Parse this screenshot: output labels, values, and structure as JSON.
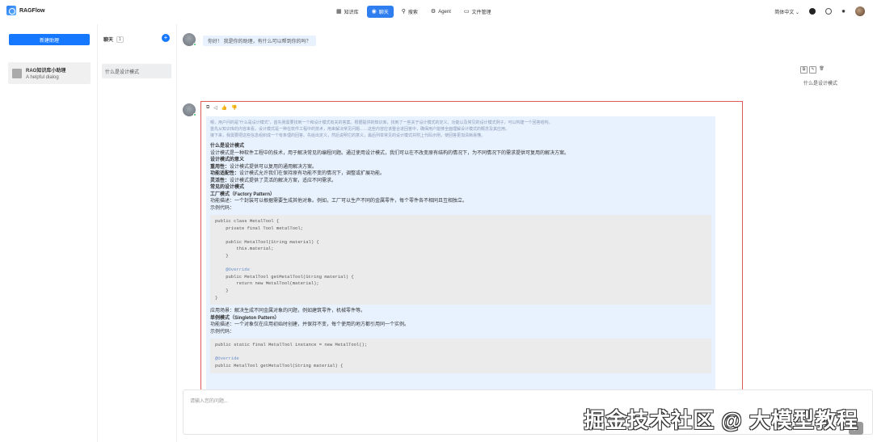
{
  "app": {
    "title": "RAGFlow"
  },
  "nav": {
    "items": [
      {
        "icon": "knowledge-base-icon",
        "label": "知识库",
        "active": false
      },
      {
        "icon": "chat-icon",
        "label": "聊天",
        "active": true
      },
      {
        "icon": "search-icon",
        "label": "搜索",
        "active": false
      },
      {
        "icon": "agent-icon",
        "label": "Agent",
        "active": false
      },
      {
        "icon": "folder-icon",
        "label": "文件管理",
        "active": false
      }
    ]
  },
  "topright": {
    "language": "简体中文"
  },
  "sidebar": {
    "new_chat_label": "新建助理",
    "assistant": {
      "name": "RAG知识库小助理",
      "description": "A helpful dialog"
    }
  },
  "conversations": {
    "title": "聊天",
    "count": "1",
    "items": [
      {
        "label": "什么是设计模式"
      }
    ]
  },
  "chat": {
    "greeting": "你好！ 我是你的助理，有什么可以帮到你的吗？",
    "user_message": "什么是设计模式",
    "thinking": [
      "嗯，用户问的是\"什么是设计模式\"，首先我需要找到一个和设计模式有关的答案。根据提供的知识库，找到了一些关于设计模式的定义、功能以及常见的设计模式例子，可以构建一个回答结构。",
      "首先从知识库的内容来看，设计模式是一种在软件工程中的技术，用来解决常见问题……这些内容应该整合进回答中，确保用户能够全面理解设计模式的概念及其应用。",
      "接下来，我需要把这些信息组织成一个有条理的回答。先给出定义，然后说明它的意义，最后列举常见的设计模式并附上代码示例，使回答更加清晰易懂。"
    ],
    "answer": {
      "h_what": "什么是设计模式",
      "p_what": "设计模式是一种软件工程中的技术，用于解决常见的编程问题。通过使用设计模式，我们可以在不改变原有结构的情况下，为不同情况下的需求提供可复用的解决方案。",
      "h_meaning": "设计模式的意义",
      "b1_label": "重用性：",
      "b1_text": "设计模式提供可以复用的通用解决方案。",
      "b2_label": "功能适配性：",
      "b2_text": "设计模式允许我们在保持原有功能不变的情况下，调整或扩展功能。",
      "b3_label": "灵活性：",
      "b3_text": "设计模式提供了灵活的解决方案，适应不同需求。",
      "h_common": "常见的设计模式",
      "h_factory": "工厂模式（Factory Pattern）",
      "p_factory": "功能描述：一个封装可以根据需要生成其他对象。例如，工厂可以生产不同的金属零件，每个零件各不相同且互相独立。",
      "code_label": "示例代码：",
      "code1": [
        "public class MetalTool {",
        "    private final Tool metalTool;",
        "",
        "    public MetalTool(String material) {",
        "        this.material;",
        "    }",
        "",
        "    @Override",
        "    public MetalTool getMetalTool(String material) {",
        "        return new MetalTool(material);",
        "    }",
        "}"
      ],
      "p_usage": "应用场景：解决生成不同金属对象的问题，例如建筑零件，机械零件等。",
      "h_singleton": "单例模式（Singleton Pattern）",
      "p_singleton": "功能描述：一个对象仅在应用初始时创建，并保持不变，每个使用的地方都引用同一个实例。",
      "code_label2": "示例代码：",
      "code2": [
        "public static final MetalTool instance = new MetalTool();",
        "",
        "@Override",
        "public MetalTool getMetalTool(String material) {"
      ]
    },
    "input_placeholder": "请输入您的问题..."
  },
  "watermark": "掘金技术社区 @ 大模型教程"
}
